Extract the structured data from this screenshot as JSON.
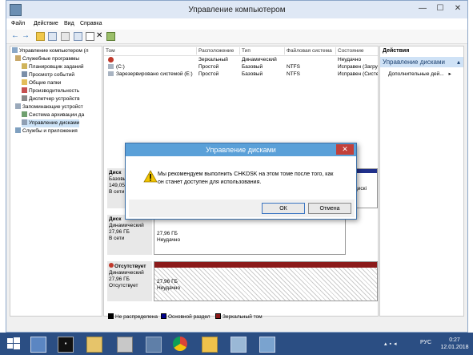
{
  "window": {
    "title": "Управление компьютером",
    "controls": [
      "—",
      "☐",
      "✕"
    ]
  },
  "menu": [
    "Файл",
    "Действие",
    "Вид",
    "Справка"
  ],
  "tree": [
    {
      "label": "Управление компьютером (л",
      "indent": 0
    },
    {
      "label": "Служебные программы",
      "indent": 1
    },
    {
      "label": "Планировщик заданий",
      "indent": 2
    },
    {
      "label": "Просмотр событий",
      "indent": 2
    },
    {
      "label": "Общие папки",
      "indent": 2
    },
    {
      "label": "Производительность",
      "indent": 2
    },
    {
      "label": "Диспетчер устройств",
      "indent": 2
    },
    {
      "label": "Запоминающие устройст",
      "indent": 1
    },
    {
      "label": "Система архивации да",
      "indent": 2
    },
    {
      "label": "Управление дисками",
      "indent": 2
    },
    {
      "label": "Службы и приложения",
      "indent": 1
    }
  ],
  "volumes": {
    "headers": [
      "Том",
      "Расположение",
      "Тип",
      "Файловая система",
      "Состояние"
    ],
    "rows": [
      [
        "",
        "Зеркальный",
        "Динамический",
        "",
        "Неудачно"
      ],
      [
        "(C:)",
        "Простой",
        "Базовый",
        "NTFS",
        "Исправен (Загру"
      ],
      [
        "Зарезервировано системой (E:)",
        "Простой",
        "Базовый",
        "NTFS",
        "Исправен (Систе"
      ]
    ]
  },
  "disks": [
    {
      "name": "Диск",
      "type": "Базовый",
      "size": "149,05 ГБ",
      "status": "В сети"
    },
    {
      "name": "Диск",
      "type": "Динамический",
      "size": "27,96 ГБ",
      "status": "В сети",
      "part_size": "27,96 ГБ",
      "part_status": "Неудачно"
    },
    {
      "name": "Отсутствует",
      "type": "Динамический",
      "size": "27,96 ГБ",
      "status": "Отсутствует",
      "part_size": "27,96 ГБ",
      "part_status": "Неудачно"
    }
  ],
  "disk0_partial": "дискі",
  "legend": [
    {
      "label": "Не распределена",
      "color": "#000000"
    },
    {
      "label": "Основной раздел",
      "color": "#00008b"
    },
    {
      "label": "Зеркальный том",
      "color": "#8b1a1a"
    }
  ],
  "actions": {
    "header": "Действия",
    "selected": "Управление дисками",
    "more": "Дополнительные дей..."
  },
  "dialog": {
    "title": "Управление дисками",
    "message": "Мы рекомендуем выполнить CHKDSK на этом томе после того, как он станет доступен для использования.",
    "ok": "ОК",
    "cancel": "Отмена"
  },
  "taskbar": {
    "lang": "РУС",
    "time": "0:27",
    "date": "12.01.2018"
  }
}
